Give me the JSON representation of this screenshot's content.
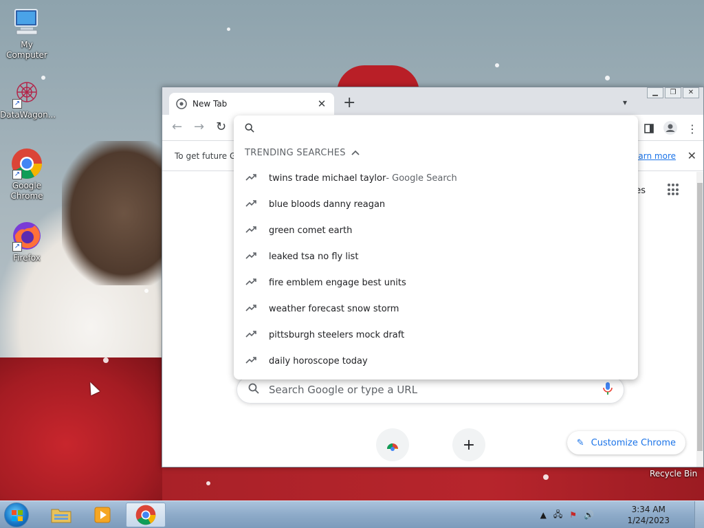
{
  "desktop": {
    "icons": [
      {
        "label": "My Computer",
        "icon": "computer-icon"
      },
      {
        "label": "DataWagon...",
        "icon": "datawagon-icon"
      },
      {
        "label": "Google Chrome",
        "icon": "chrome-icon"
      },
      {
        "label": "Firefox",
        "icon": "firefox-icon"
      }
    ],
    "recycle_bin": "Recycle Bin"
  },
  "browser": {
    "tab_title": "New Tab",
    "infobar_text": "To get future G",
    "infobar_link": "earn more",
    "images_label": "ges",
    "searchbox_placeholder": "Search Google or type a URL",
    "customize_label": "Customize Chrome"
  },
  "omnibox": {
    "trending_header": "TRENDING SEARCHES",
    "suggestions": [
      {
        "text": "twins trade michael taylor",
        "suffix": " - Google Search"
      },
      {
        "text": "blue bloods danny reagan",
        "suffix": ""
      },
      {
        "text": "green comet earth",
        "suffix": ""
      },
      {
        "text": "leaked tsa no fly list",
        "suffix": ""
      },
      {
        "text": "fire emblem engage best units",
        "suffix": ""
      },
      {
        "text": "weather forecast snow storm",
        "suffix": ""
      },
      {
        "text": "pittsburgh steelers mock draft",
        "suffix": ""
      },
      {
        "text": "daily horoscope today",
        "suffix": ""
      }
    ]
  },
  "taskbar": {
    "time": "3:34 AM",
    "date": "1/24/2023"
  },
  "colors": {
    "accent": "#1a73e8",
    "taskbar": "#8eabc9",
    "tab_strip": "#dee1e6"
  }
}
